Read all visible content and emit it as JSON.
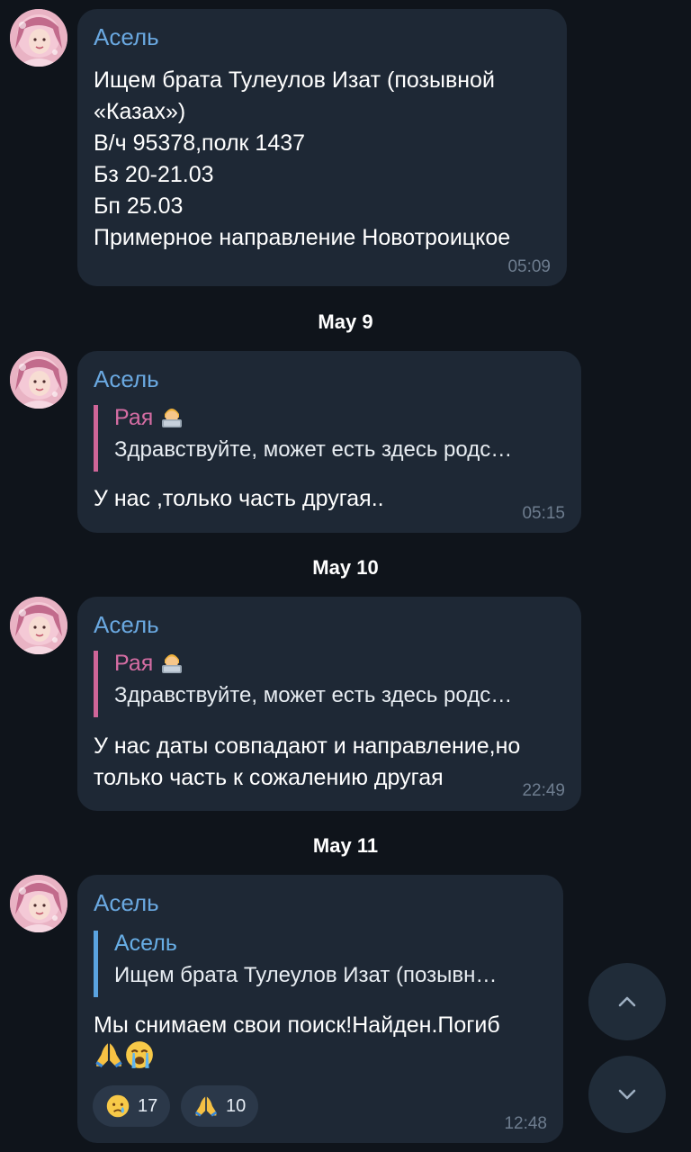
{
  "colors": {
    "background": "#0f141b",
    "bubble": "#1e2835",
    "sender": "#6aa8e0",
    "reply_pink": "#d56da3",
    "reply_blue": "#68aee6",
    "time": "#6e7d8f"
  },
  "messages": [
    {
      "sender": "Асель",
      "lines": [
        "Ищем брата Тулеулов Изат (позывной",
        "«Казах»)",
        "В/ч 95378,полк 1437",
        "Бз 20-21.03",
        "Бп 25.03",
        "Примерное направление Новотроицкое"
      ],
      "time": "05:09"
    },
    {
      "date": "May 9",
      "sender": "Асель",
      "reply": {
        "name": "Рая",
        "icon": "technologist-emoji",
        "text": "Здравствуйте, может есть здесь родс…"
      },
      "lines": [
        "У нас ,только часть другая.."
      ],
      "time": "05:15"
    },
    {
      "date": "May 10",
      "sender": "Асель",
      "reply": {
        "name": "Рая",
        "icon": "technologist-emoji",
        "text": "Здравствуйте, может есть здесь родс…"
      },
      "lines": [
        "У нас даты совпадают и направление,но",
        "только часть к сожалению другая"
      ],
      "time": "22:49"
    },
    {
      "date": "May 11",
      "sender": "Асель",
      "reply": {
        "name": "Асель",
        "text": "Ищем брата Тулеулов Изат (позывн…"
      },
      "lines": [
        "Мы снимаем свои поиск!Найден.Погиб"
      ],
      "emoji_line": [
        "folded-hands-emoji",
        "loudly-crying-emoji"
      ],
      "reactions": [
        {
          "icon": "crying-face-emoji",
          "count": "17"
        },
        {
          "icon": "folded-hands-emoji",
          "count": "10"
        }
      ],
      "time": "12:48"
    }
  ],
  "buttons": {
    "scroll_up": "chevron-up-icon",
    "scroll_down": "chevron-down-icon"
  }
}
